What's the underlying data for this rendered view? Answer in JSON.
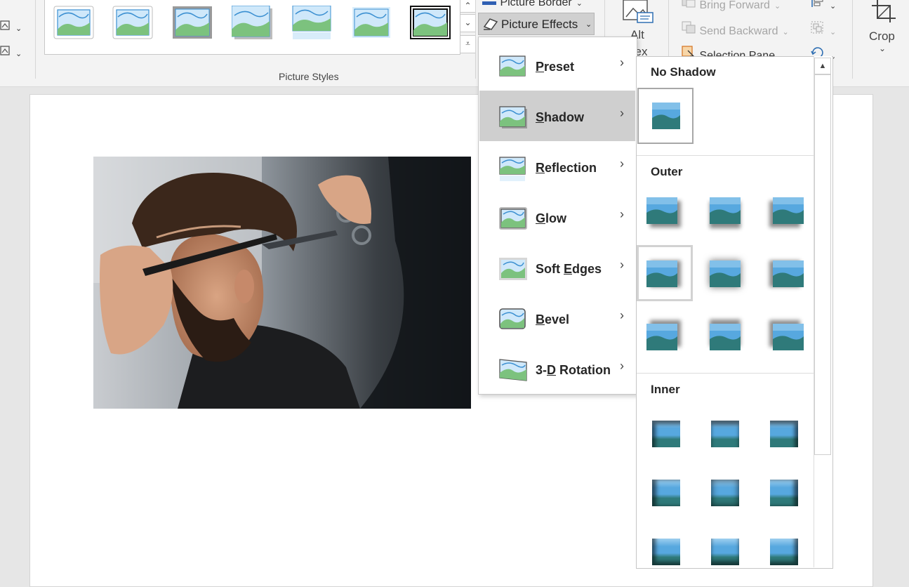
{
  "ribbon": {
    "picture_styles_label": "Picture Styles",
    "picture_border_label": "Picture Border",
    "picture_effects_label": "Picture Effects",
    "alt_text_label_line1": "Alt",
    "alt_text_label_line2": "Text",
    "bring_forward_label": "Bring Forward",
    "send_backward_label": "Send Backward",
    "selection_pane_label": "Selection Pane",
    "crop_label": "Crop"
  },
  "effects_menu": {
    "items": [
      {
        "label": "Preset",
        "accel": "P",
        "rest": "reset"
      },
      {
        "label": "Shadow",
        "accel": "S",
        "rest": "hadow"
      },
      {
        "label": "Reflection",
        "accel": "R",
        "rest": "eflection"
      },
      {
        "label": "Glow",
        "accel": "G",
        "rest": "low"
      },
      {
        "label": "Soft Edges",
        "pre": "Soft ",
        "accel": "E",
        "rest": "dges"
      },
      {
        "label": "Bevel",
        "accel": "B",
        "rest": "evel"
      },
      {
        "label": "3-D Rotation",
        "pre": "3-",
        "accel": "D",
        "rest": " Rotation"
      }
    ],
    "selected": "Shadow"
  },
  "shadow_gallery": {
    "no_shadow_heading": "No Shadow",
    "outer_heading": "Outer",
    "inner_heading": "Inner"
  },
  "colors": {
    "menu_selected_bg": "#cfcfcf",
    "icon_sky": "#4aa3dc",
    "icon_hill": "#7cc27e"
  }
}
